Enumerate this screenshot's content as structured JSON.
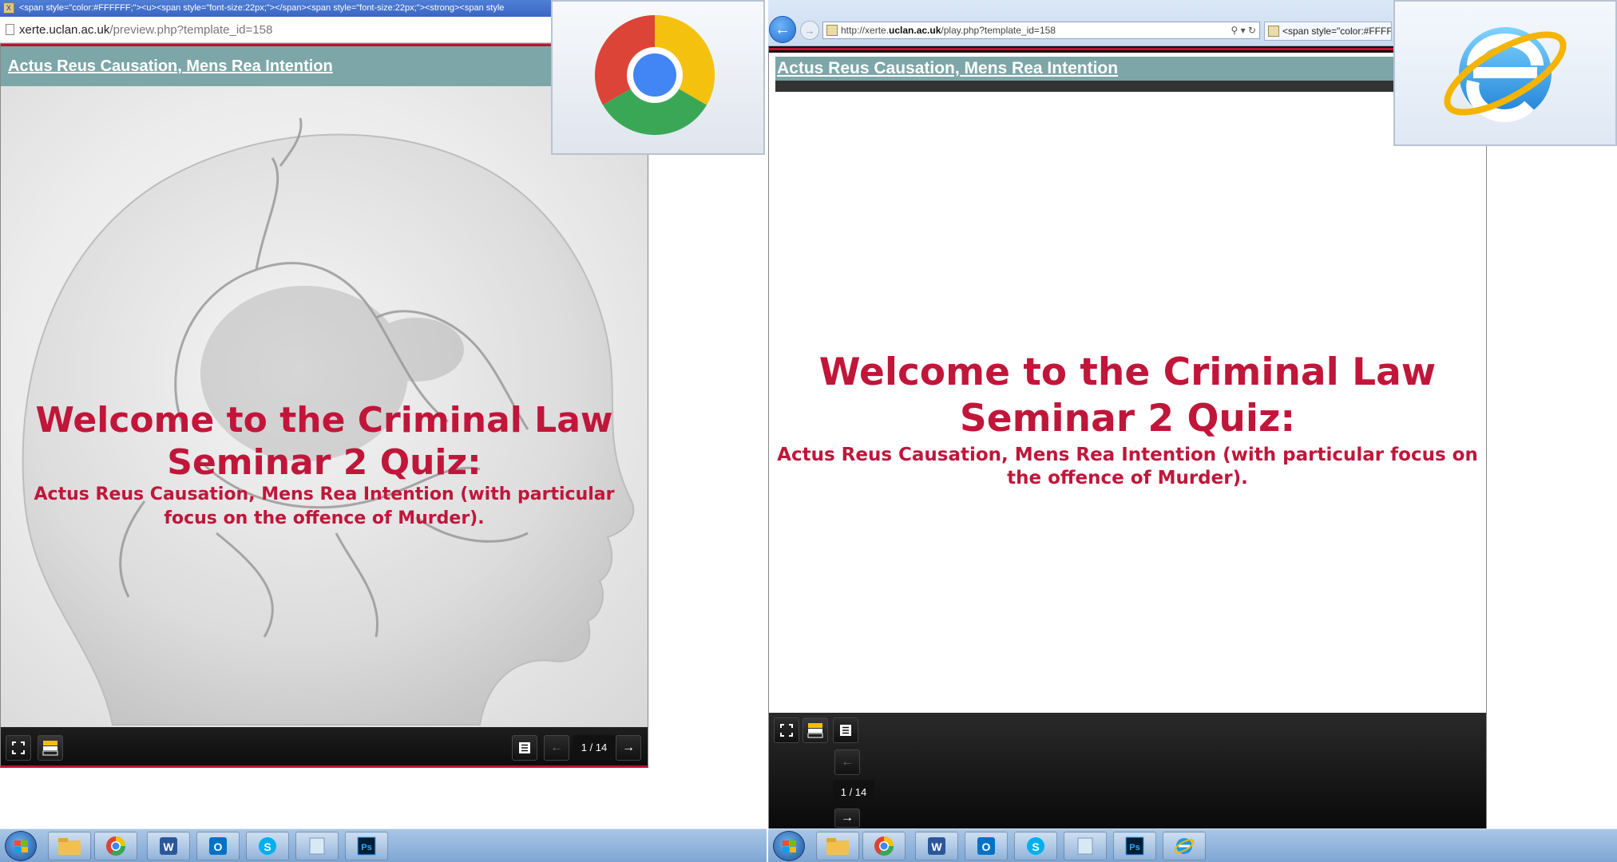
{
  "left_browser": {
    "tab_title": "<span style=\"color:#FFFFFF;\"><u><span style=\"font-size:22px;\"></span><span style=\"font-size:22px;\"><strong><span style",
    "url_domain": "xerte.uclan.ac.uk",
    "url_path": "/preview.php?template_id=158",
    "banner_title": "Actus Reus Causation, Mens Rea Intention",
    "heading_line1": "Welcome to the Criminal Law",
    "heading_line2": "Seminar 2 Quiz:",
    "subheading": "Actus Reus Causation, Mens Rea Intention (with particular focus on the offence of Murder).",
    "page_counter": "1 / 14"
  },
  "right_browser": {
    "url_prefix": "http://xerte.",
    "url_domain": "uclan.ac.uk",
    "url_path": "/play.php?template_id=158",
    "tab_title": "<span style=\"color:#FFFFF",
    "banner_title": "Actus Reus Causation, Mens Rea Intention",
    "heading_line1": "Welcome to the Criminal Law",
    "heading_line2": "Seminar 2 Quiz:",
    "subheading": "Actus Reus Causation, Mens Rea Intention (with particular focus on the offence of Murder).",
    "page_counter": "1 / 14"
  },
  "icons": {
    "fullscreen": "fullscreen-icon",
    "accessibility": "accessibility-icon",
    "menu": "menu-icon",
    "prev": "arrow-left-icon",
    "next": "arrow-right-icon"
  },
  "colors": {
    "accent_red": "#c0163a",
    "banner_teal": "#7da6a8",
    "control_bar": "#111111"
  }
}
